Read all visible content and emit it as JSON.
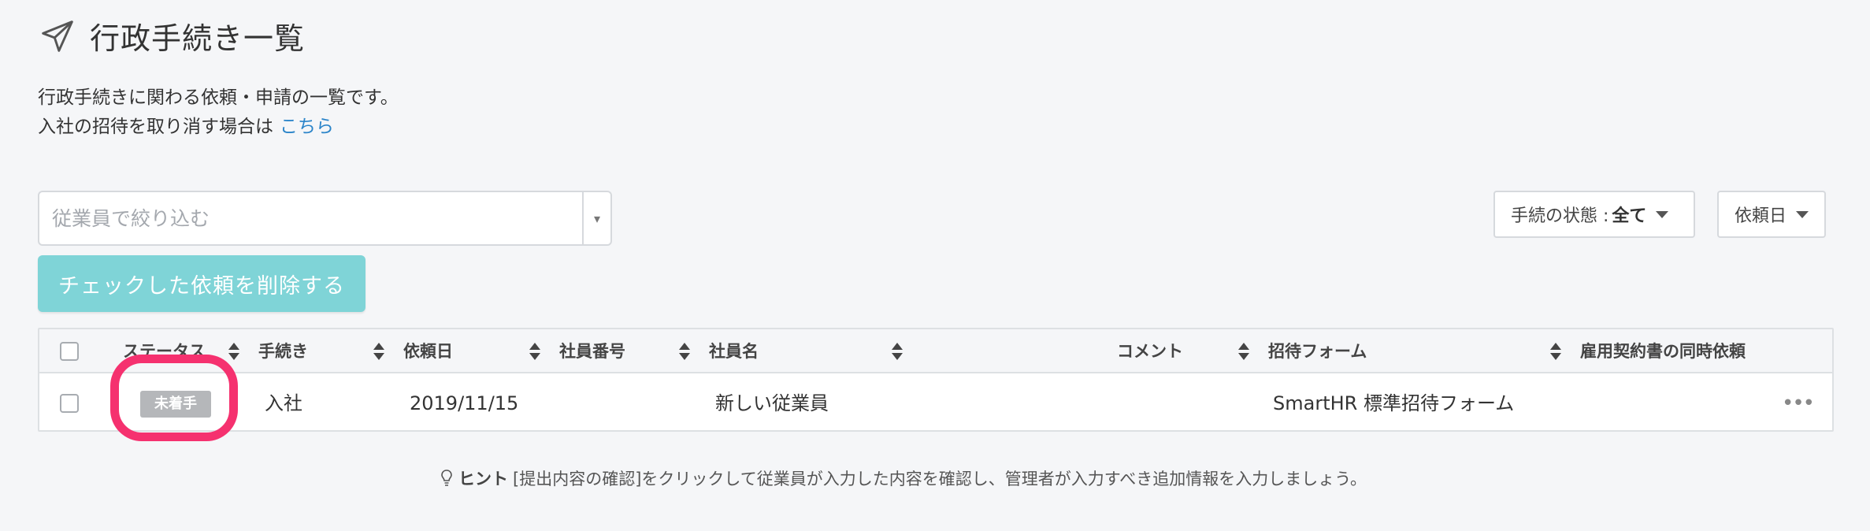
{
  "header": {
    "icon": "paper-plane-icon",
    "title": "行政手続き一覧"
  },
  "description": {
    "line1": "行政手続きに関わる依頼・申請の一覧です。",
    "line2": "入社の招待を取り消す場合は",
    "link": "こちら"
  },
  "filter": {
    "placeholder": "従業員で絞り込む",
    "delete_button": "チェックした依頼を削除する"
  },
  "status_select": {
    "label": "手続の状態 :",
    "value": "全て"
  },
  "date_select": {
    "label": "依頼日"
  },
  "table": {
    "columns": [
      "ステータス",
      "手続き",
      "依頼日",
      "社員番号",
      "社員名",
      "コメント",
      "招待フォーム",
      "雇用契約書の同時依頼"
    ],
    "rows": [
      {
        "status": "未着手",
        "procedure": "入社",
        "date": "2019/11/15",
        "employee_number": "",
        "employee_name": "新しい従業員",
        "comment": "",
        "invite_form": "SmartHR 標準招待フォーム",
        "contract": ""
      }
    ]
  },
  "hint": {
    "label": "ヒント",
    "text": "[提出内容の確認]をクリックして従業員が入力した内容を確認し、管理者が入力すべき追加情報を入力しましょう。"
  },
  "colors": {
    "accent": "#7fd4d7",
    "link": "#2a84c9",
    "highlight": "#f5316f",
    "badge": "#b5b7ba"
  }
}
